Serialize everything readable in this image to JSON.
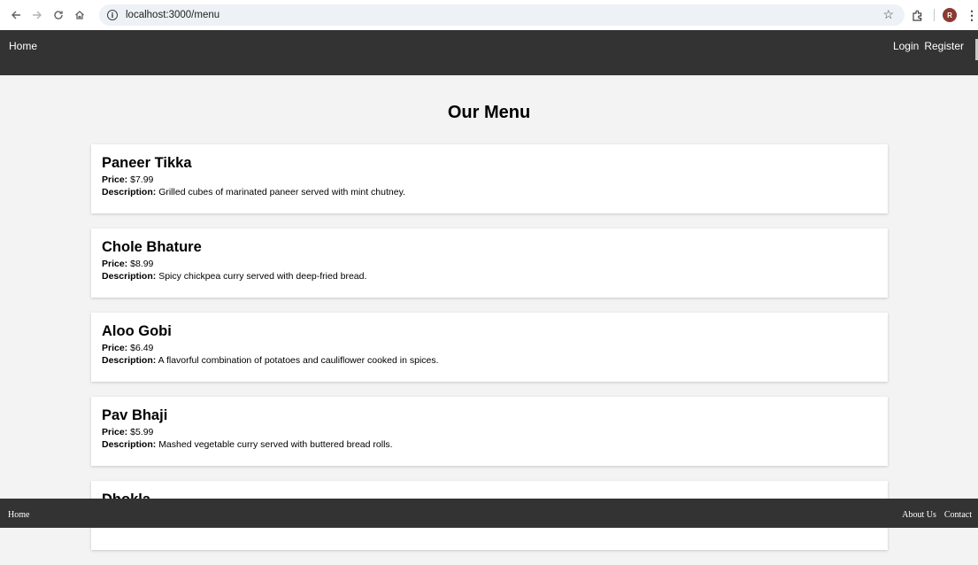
{
  "browser": {
    "url": "localhost:3000/menu",
    "avatar_letter": "R"
  },
  "header": {
    "home": "Home",
    "login": "Login",
    "register": "Register"
  },
  "main": {
    "title": "Our Menu",
    "price_label": "Price:",
    "description_label": "Description:",
    "items": [
      {
        "name": "Paneer Tikka",
        "price": "$7.99",
        "description": "Grilled cubes of marinated paneer served with mint chutney."
      },
      {
        "name": "Chole Bhature",
        "price": "$8.99",
        "description": "Spicy chickpea curry served with deep-fried bread."
      },
      {
        "name": "Aloo Gobi",
        "price": "$6.49",
        "description": "A flavorful combination of potatoes and cauliflower cooked in spices."
      },
      {
        "name": "Pav Bhaji",
        "price": "$5.99",
        "description": "Mashed vegetable curry served with buttered bread rolls."
      },
      {
        "name": "Dhokla",
        "price": "",
        "description": ""
      }
    ]
  },
  "footer": {
    "home": "Home",
    "about": "About Us",
    "contact": "Contact"
  },
  "colors": {
    "bar_bg": "#333333",
    "page_bg": "#f3f3f3",
    "card_bg": "#ffffff"
  }
}
